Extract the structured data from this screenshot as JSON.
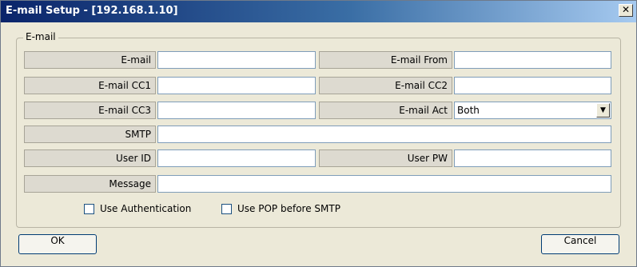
{
  "window": {
    "title": "E-mail Setup - [192.168.1.10]",
    "close_glyph": "✕"
  },
  "group": {
    "label": "E-mail"
  },
  "fields": {
    "email": {
      "label": "E-mail",
      "value": ""
    },
    "email_from": {
      "label": "E-mail From",
      "value": ""
    },
    "email_cc1": {
      "label": "E-mail CC1",
      "value": ""
    },
    "email_cc2": {
      "label": "E-mail CC2",
      "value": ""
    },
    "email_cc3": {
      "label": "E-mail CC3",
      "value": ""
    },
    "email_act": {
      "label": "E-mail Act",
      "value": "Both"
    },
    "smtp": {
      "label": "SMTP",
      "value": ""
    },
    "user_id": {
      "label": "User ID",
      "value": ""
    },
    "user_pw": {
      "label": "User PW",
      "value": ""
    },
    "message": {
      "label": "Message",
      "value": ""
    }
  },
  "options": {
    "use_authentication": {
      "label": "Use Authentication",
      "checked": false
    },
    "use_pop": {
      "label": "Use POP before SMTP",
      "checked": false
    }
  },
  "buttons": {
    "ok": "OK",
    "cancel": "Cancel"
  },
  "icons": {
    "dropdown_arrow": "dropdown-arrow-icon",
    "close": "close-icon"
  },
  "colors": {
    "titlebar_start": "#0a246a",
    "titlebar_end": "#a6caf0",
    "dialog_bg": "#ece9d8"
  }
}
